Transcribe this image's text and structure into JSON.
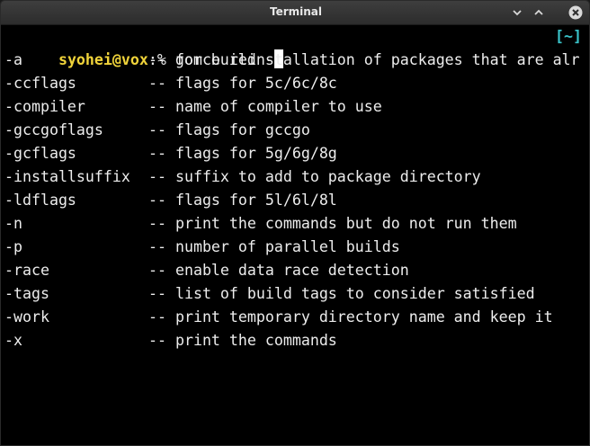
{
  "window": {
    "title": "Terminal"
  },
  "terminal": {
    "prompt_user": "syohei@vox",
    "prompt_symbol": ":% ",
    "command": "gom build -",
    "right_prompt": "[~]",
    "completions": [
      {
        "flag": "-a",
        "description": "-- force reinstallation of packages that are alr"
      },
      {
        "flag": "-ccflags",
        "description": "-- flags for 5c/6c/8c"
      },
      {
        "flag": "-compiler",
        "description": "-- name of compiler to use"
      },
      {
        "flag": "-gccgoflags",
        "description": "-- flags for gccgo"
      },
      {
        "flag": "-gcflags",
        "description": "-- flags for 5g/6g/8g"
      },
      {
        "flag": "-installsuffix",
        "description": "-- suffix to add to package directory"
      },
      {
        "flag": "-ldflags",
        "description": "-- flags for 5l/6l/8l"
      },
      {
        "flag": "-n",
        "description": "-- print the commands but do not run them"
      },
      {
        "flag": "-p",
        "description": "-- number of parallel builds"
      },
      {
        "flag": "-race",
        "description": "-- enable data race detection"
      },
      {
        "flag": "-tags",
        "description": "-- list of build tags to consider satisfied"
      },
      {
        "flag": "-work",
        "description": "-- print temporary directory name and keep it"
      },
      {
        "flag": "-x",
        "description": "-- print the commands"
      }
    ]
  },
  "colors": {
    "background": "#000000",
    "foreground": "#ededed",
    "prompt_user": "#f0d33a",
    "right_prompt": "#39c2c8"
  },
  "icons": {
    "minimize": "chevron-down-icon",
    "maximize": "chevron-up-icon",
    "close": "close-icon"
  }
}
